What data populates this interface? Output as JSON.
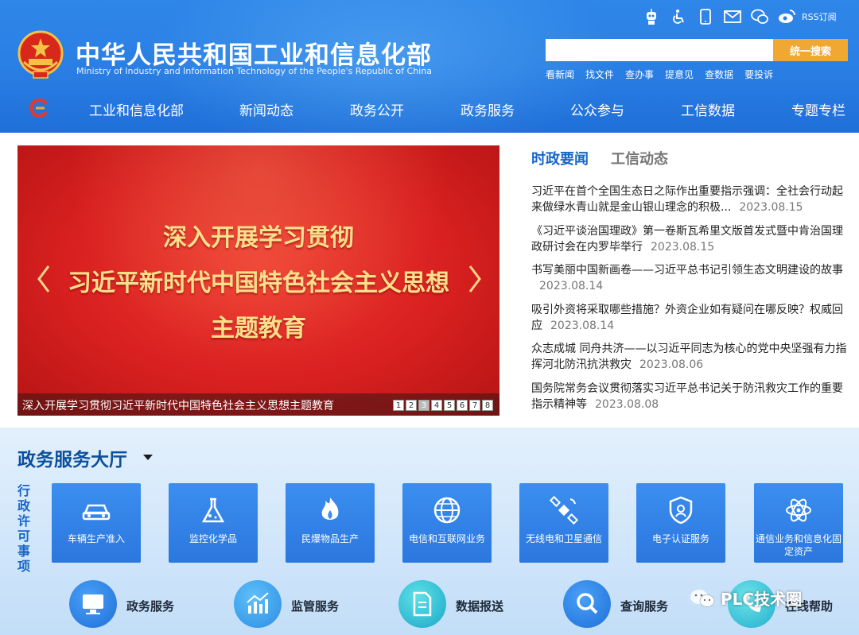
{
  "header": {
    "title_zh": "中华人民共和国工业和信息化部",
    "title_en": "Ministry of Industry and Information Technology of the People's Republic of China",
    "rss_label": "RSS订阅",
    "search": {
      "placeholder": "",
      "button_label": "统一搜索"
    },
    "quick_links": [
      "看新闻",
      "找文件",
      "查办事",
      "提意见",
      "查数据",
      "要投诉"
    ],
    "utility_icons": [
      "robot-icon",
      "accessibility-icon",
      "mobile-icon",
      "mail-icon",
      "wechat-icon",
      "weibo-icon"
    ]
  },
  "nav": {
    "items": [
      "工业和信息化部",
      "新闻动态",
      "政务公开",
      "政务服务",
      "公众参与",
      "工信数据",
      "专题专栏"
    ]
  },
  "slider": {
    "line1": "深入开展学习贯彻",
    "line2": "习近平新时代中国特色社会主义思想",
    "line3": "主题教育",
    "caption": "深入开展学习贯彻习近平新时代中国特色社会主义思想主题教育",
    "pages": [
      "1",
      "2",
      "3",
      "4",
      "5",
      "6",
      "7",
      "8"
    ],
    "active_page": 3
  },
  "news": {
    "tabs": [
      "时政要闻",
      "工信动态"
    ],
    "items": [
      {
        "title": "习近平在首个全国生态日之际作出重要指示强调：全社会行动起来做绿水青山就是金山银山理念的积极...",
        "date": "2023.08.15"
      },
      {
        "title": "《习近平谈治国理政》第一卷斯瓦希里文版首发式暨中肯治国理政研讨会在内罗毕举行",
        "date": "2023.08.15"
      },
      {
        "title": "书写美丽中国新画卷——习近平总书记引领生态文明建设的故事",
        "date": "2023.08.14"
      },
      {
        "title": "吸引外资将采取哪些措施？外资企业如有疑问在哪反映？权威回应",
        "date": "2023.08.14"
      },
      {
        "title": "众志成城 同舟共济——以习近平同志为核心的党中央坚强有力指挥河北防汛抗洪救灾",
        "date": "2023.08.06"
      },
      {
        "title": "国务院常务会议贯彻落实习近平总书记关于防汛救灾工作的重要指示精神等",
        "date": "2023.08.08"
      }
    ]
  },
  "service": {
    "title": "政务服务大厅",
    "vertical_label": "行政许可事项",
    "cards": [
      {
        "label": "车辆生产准入",
        "icon": "car-icon"
      },
      {
        "label": "监控化学品",
        "icon": "flask-icon"
      },
      {
        "label": "民爆物品生产",
        "icon": "flame-icon"
      },
      {
        "label": "电信和互联网业务",
        "icon": "globe-icon"
      },
      {
        "label": "无线电和卫星通信",
        "icon": "satellite-icon"
      },
      {
        "label": "电子认证服务",
        "icon": "shield-icon"
      },
      {
        "label": "通信业务和信息化固定资产",
        "icon": "atom-icon"
      }
    ],
    "bottom": [
      {
        "label": "政务服务",
        "icon": "monitor-icon"
      },
      {
        "label": "监管服务",
        "icon": "chart-icon"
      },
      {
        "label": "数据报送",
        "icon": "document-icon"
      },
      {
        "label": "查询服务",
        "icon": "search-icon"
      },
      {
        "label": "在线帮助",
        "icon": "phone-icon"
      }
    ]
  },
  "watermark": {
    "text": "PLC技术圈"
  },
  "colors": {
    "header_blue": "#2a7fe4",
    "accent_orange": "#f0a832",
    "tab_active": "#1766c6",
    "slider_red": "#d92020"
  }
}
